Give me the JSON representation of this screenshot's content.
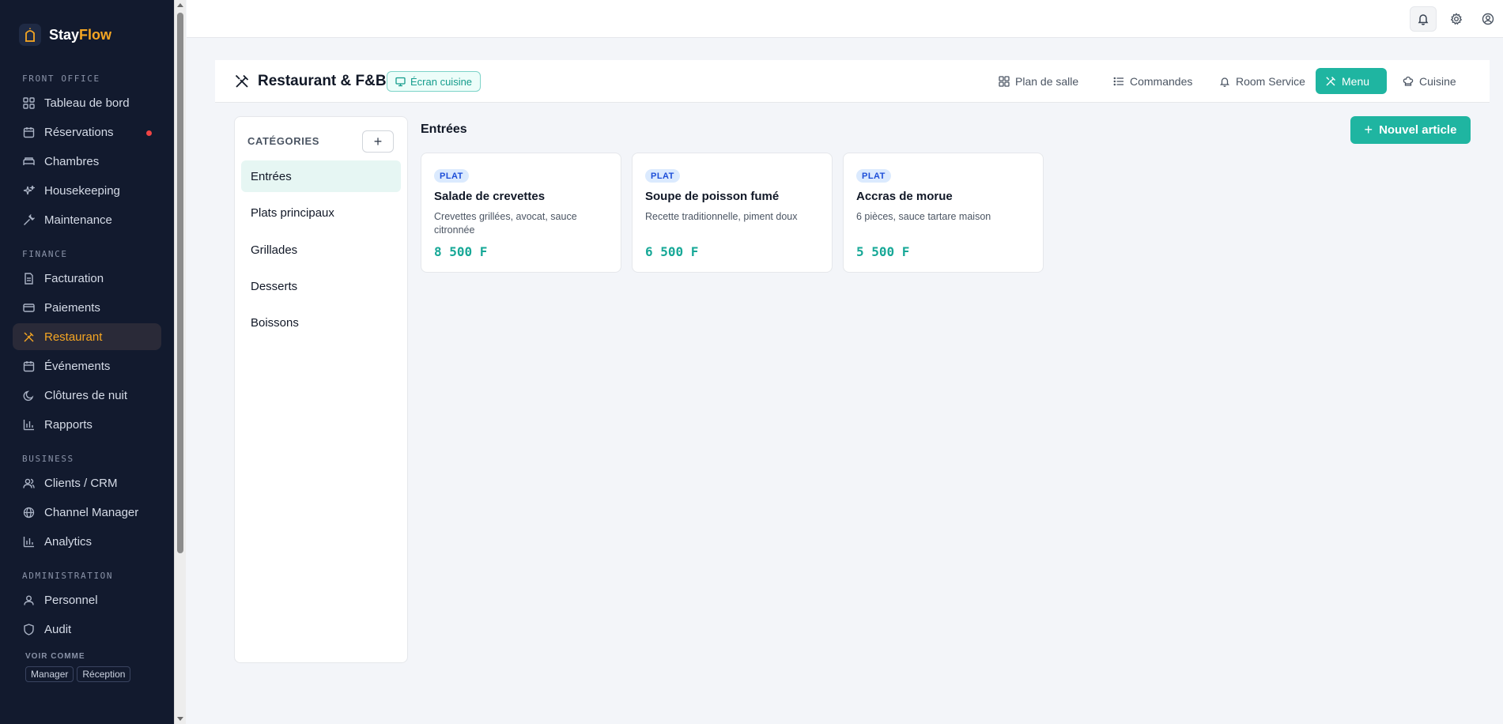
{
  "brand": {
    "name_main": "Stay",
    "name_accent": "Flow"
  },
  "sidebar": {
    "sections": [
      {
        "title": "FRONT OFFICE",
        "items": [
          {
            "label": "Tableau de bord",
            "icon": "grid-icon"
          },
          {
            "label": "Réservations",
            "icon": "calendar-icon",
            "dot": true
          },
          {
            "label": "Chambres",
            "icon": "bed-icon"
          },
          {
            "label": "Housekeeping",
            "icon": "sparkles-icon"
          },
          {
            "label": "Maintenance",
            "icon": "wrench-icon"
          }
        ]
      },
      {
        "title": "FINANCE",
        "items": [
          {
            "label": "Facturation",
            "icon": "file-icon"
          },
          {
            "label": "Paiements",
            "icon": "card-icon"
          },
          {
            "label": "Restaurant",
            "icon": "utensils-icon",
            "active": true
          },
          {
            "label": "Événements",
            "icon": "calendar-icon"
          },
          {
            "label": "Clôtures de nuit",
            "icon": "moon-icon"
          },
          {
            "label": "Rapports",
            "icon": "bar-chart-icon"
          }
        ]
      },
      {
        "title": "BUSINESS",
        "items": [
          {
            "label": "Clients / CRM",
            "icon": "users-icon"
          },
          {
            "label": "Channel Manager",
            "icon": "globe-icon"
          },
          {
            "label": "Analytics",
            "icon": "bar-chart-icon"
          }
        ]
      },
      {
        "title": "ADMINISTRATION",
        "items": [
          {
            "label": "Personnel",
            "icon": "users-icon"
          },
          {
            "label": "Audit",
            "icon": "shield-icon"
          }
        ]
      }
    ],
    "voir_comme": "VOIR COMME",
    "roles": [
      "Manager",
      "Réception"
    ]
  },
  "module": {
    "title": "Restaurant & F&B",
    "kitchen_badge": "Écran cuisine",
    "tabs": [
      {
        "label": "Plan de salle",
        "icon": "grid-icon"
      },
      {
        "label": "Commandes",
        "icon": "list-icon"
      },
      {
        "label": "Room Service",
        "icon": "bell-icon"
      },
      {
        "label": "Menu",
        "icon": "utensils-icon",
        "active": true
      },
      {
        "label": "Cuisine",
        "icon": "chef-hat-icon"
      }
    ]
  },
  "categories": {
    "title": "CATÉGORIES",
    "add_label": "+",
    "items": [
      {
        "label": "Entrées",
        "active": true
      },
      {
        "label": "Plats principaux"
      },
      {
        "label": "Grillades"
      },
      {
        "label": "Desserts"
      },
      {
        "label": "Boissons"
      }
    ]
  },
  "main": {
    "heading": "Entrées",
    "new_button": "Nouvel article",
    "items": [
      {
        "badge": "PLAT",
        "name": "Salade de crevettes",
        "description": "Crevettes grillées, avocat, sauce citronnée",
        "price": "8 500 F"
      },
      {
        "badge": "PLAT",
        "name": "Soupe de poisson fumé",
        "description": "Recette traditionnelle, piment doux",
        "price": "6 500 F"
      },
      {
        "badge": "PLAT",
        "name": "Accras de morue",
        "description": "6 pièces, sauce tartare maison",
        "price": "5 500 F"
      }
    ]
  },
  "colors": {
    "accent": "#1fb5a1",
    "sidebar_bg": "#121a2e",
    "brand_accent": "#f5a623",
    "alert": "#ef4444"
  }
}
